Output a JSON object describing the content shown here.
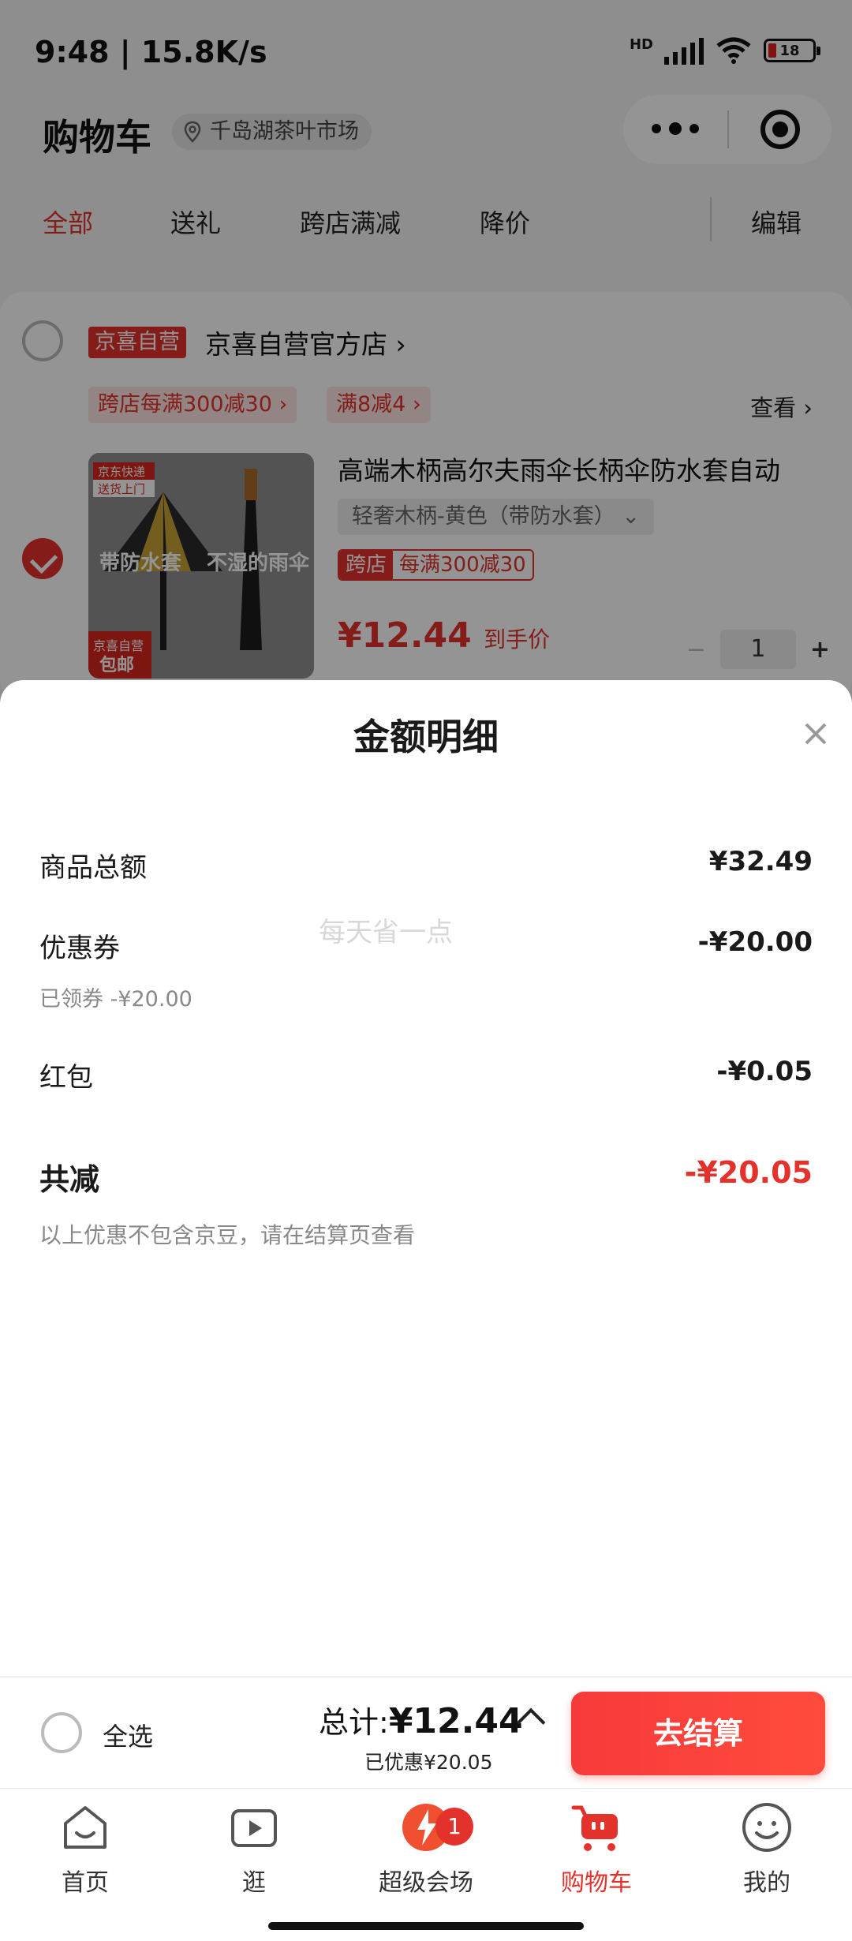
{
  "status": {
    "time": "9:48 | 15.8K/s",
    "network": "HD",
    "wifi_level": "6",
    "battery": "18"
  },
  "header": {
    "title": "购物车",
    "location": "千岛湖茶叶市场"
  },
  "tabs": [
    {
      "label": "全部",
      "active": true
    },
    {
      "label": "送礼"
    },
    {
      "label": "跨店满减"
    },
    {
      "label": "降价"
    },
    {
      "label": "编辑"
    }
  ],
  "store": {
    "tag": "京喜自营",
    "name": "京喜自营官方店 ›",
    "promos": [
      "跨店每满300减30 ›",
      "满8减4 ›"
    ],
    "see": "查看 ›"
  },
  "product": {
    "name": "高端木柄高尔夫雨伞长柄伞防水套自动",
    "spec": "轻奢木柄-黄色（带防水套）  ⌄",
    "cross_tag": "跨店",
    "cross_promo": "每满300减30",
    "price": "¥12.44",
    "price_label": "到手价",
    "qty": "1",
    "image_top_text": "京东快递",
    "image_top_sub": "送货上门",
    "image_text_left": "带防水套",
    "image_text_right": "不湿的雨伞",
    "image_badge_top": "京喜自营",
    "image_badge_bottom": "包邮"
  },
  "sheet": {
    "title": "金额明细",
    "watermark": "每天省一点",
    "rows": {
      "goods_label": "商品总额",
      "goods_value": "¥32.49",
      "coupon_label": "优惠券",
      "coupon_value": "-¥20.00",
      "coupon_sub": "已领券 -¥20.00",
      "redpack_label": "红包",
      "redpack_value": "-¥0.05",
      "total_label": "共减",
      "total_value": "-¥20.05",
      "note": "以上优惠不包含京豆，请在结算页查看"
    }
  },
  "checkout": {
    "select_all": "全选",
    "total_prefix": "总计:",
    "total_value": "¥12.44",
    "saved": "已优惠¥20.05",
    "button": "去结算"
  },
  "nav": [
    {
      "label": "首页",
      "icon": "home-icon"
    },
    {
      "label": "逛",
      "icon": "play-icon"
    },
    {
      "label": "超级会场",
      "icon": "venue-icon",
      "badge": "1"
    },
    {
      "label": "购物车",
      "icon": "cart-icon",
      "active": true
    },
    {
      "label": "我的",
      "icon": "profile-icon"
    }
  ],
  "colors": {
    "accent": "#e3322c",
    "checkout_gradient_start": "#f63a3a",
    "checkout_gradient_end": "#ff4b3d"
  }
}
